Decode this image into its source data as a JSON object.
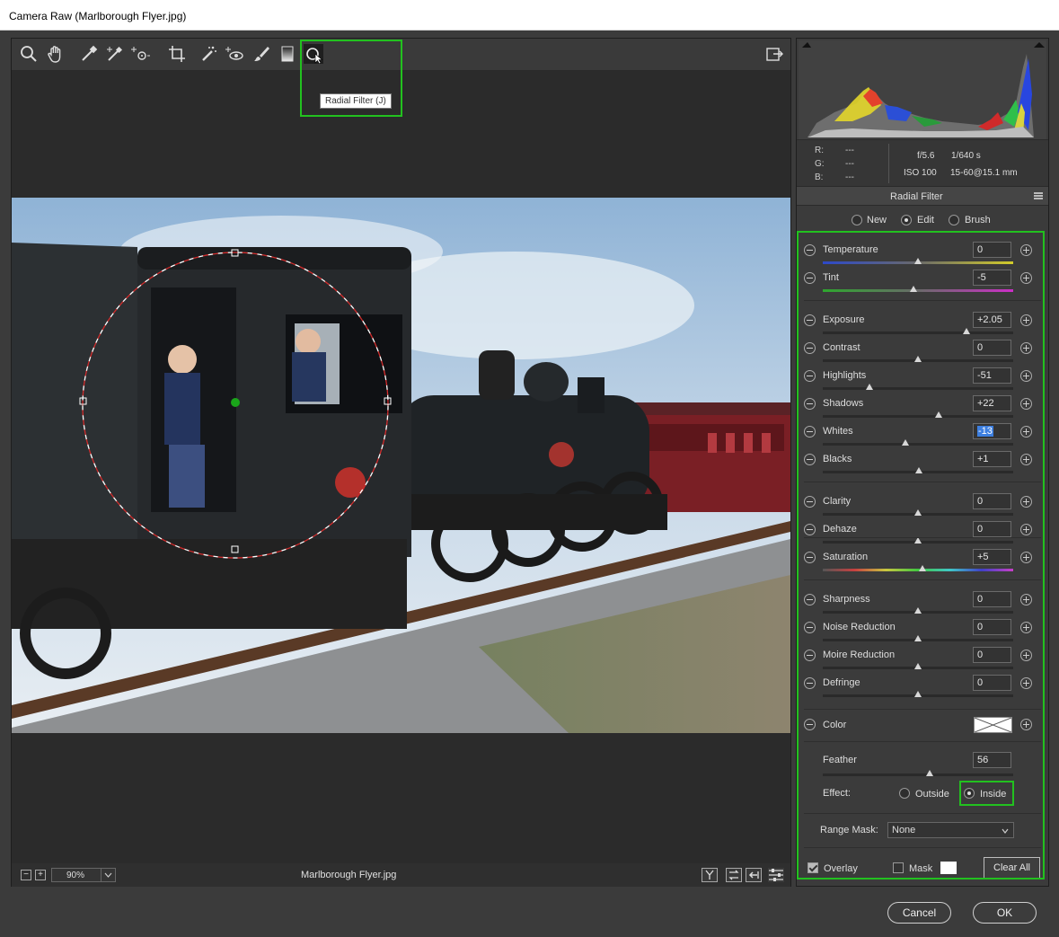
{
  "window": {
    "title": "Camera Raw (Marlborough Flyer.jpg)"
  },
  "toolbar": {
    "tools": [
      "zoom-icon",
      "hand-icon",
      "white-balance-icon",
      "color-sampler-icon",
      "targeted-adjustment-icon",
      "crop-icon",
      "spot-removal-icon",
      "red-eye-icon",
      "adjustment-brush-icon",
      "graduated-filter-icon",
      "radial-filter-icon"
    ],
    "tooltip": "Radial Filter (J)"
  },
  "status": {
    "zoom": "90%",
    "filename": "Marlborough Flyer.jpg",
    "zoom_out": "−",
    "zoom_in": "+"
  },
  "histogram": {
    "r_label": "R:",
    "g_label": "G:",
    "b_label": "B:",
    "r": "---",
    "g": "---",
    "b": "---",
    "aperture": "f/5.6",
    "shutter": "1/640 s",
    "iso": "ISO 100",
    "lens": "15-60@15.1 mm"
  },
  "panel": {
    "title": "Radial Filter",
    "modes": [
      {
        "label": "New",
        "selected": false
      },
      {
        "label": "Edit",
        "selected": true
      },
      {
        "label": "Brush",
        "selected": false
      }
    ],
    "sliders": [
      {
        "label": "Temperature",
        "value": "0",
        "pos": 0.5
      },
      {
        "label": "Tint",
        "value": "-5",
        "pos": 0.475
      },
      {
        "label": "Exposure",
        "value": "+2.05",
        "pos": 0.755
      },
      {
        "label": "Contrast",
        "value": "0",
        "pos": 0.5
      },
      {
        "label": "Highlights",
        "value": "-51",
        "pos": 0.245
      },
      {
        "label": "Shadows",
        "value": "+22",
        "pos": 0.61
      },
      {
        "label": "Whites",
        "value": "-13",
        "pos": 0.435
      },
      {
        "label": "Blacks",
        "value": "+1",
        "pos": 0.505
      },
      {
        "label": "Clarity",
        "value": "0",
        "pos": 0.5
      },
      {
        "label": "Dehaze",
        "value": "0",
        "pos": 0.5
      },
      {
        "label": "Saturation",
        "value": "+5",
        "pos": 0.525
      },
      {
        "label": "Sharpness",
        "value": "0",
        "pos": 0.5
      },
      {
        "label": "Noise Reduction",
        "value": "0",
        "pos": 0.5
      },
      {
        "label": "Moire Reduction",
        "value": "0",
        "pos": 0.5
      },
      {
        "label": "Defringe",
        "value": "0",
        "pos": 0.5
      }
    ],
    "color_label": "Color",
    "feather_label": "Feather",
    "feather_value": "56",
    "feather_pos": 0.56,
    "effect_label": "Effect:",
    "outside_label": "Outside",
    "inside_label": "Inside",
    "range_mask_label": "Range Mask:",
    "range_mask_value": "None",
    "overlay_label": "Overlay",
    "overlay_checked": true,
    "mask_label": "Mask",
    "mask_checked": false,
    "clear_all_label": "Clear All"
  },
  "dialog": {
    "cancel_label": "Cancel",
    "ok_label": "OK"
  },
  "colors": {
    "highlight": "#22c11f",
    "pin": "#1aa51a",
    "filter_ring": "#d12c2c"
  }
}
